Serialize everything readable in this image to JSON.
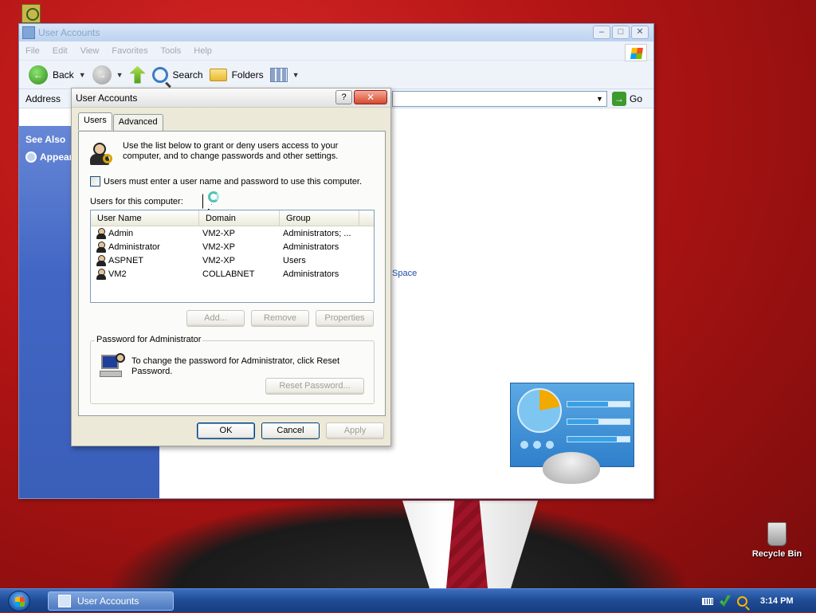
{
  "desktop": {
    "recycle_bin_label": "Recycle Bin"
  },
  "explorer": {
    "title": "User Accounts",
    "menu": [
      "File",
      "Edit",
      "View",
      "Favorites",
      "Tools",
      "Help"
    ],
    "toolbar": {
      "back_label": "Back",
      "search_label": "Search",
      "folders_label": "Folders"
    },
    "address_label": "Address",
    "go_label": "Go",
    "side_pane": {
      "see_also_label": "See Also",
      "appearance_label": "Appear"
    },
    "content_link_fragment": "Space"
  },
  "dialog": {
    "title": "User Accounts",
    "help_glyph": "?",
    "close_glyph": "✕",
    "tabs": [
      {
        "label": "Users",
        "active": true
      },
      {
        "label": "Advanced",
        "active": false
      }
    ],
    "intro_text": "Use the list below to grant or deny users access to your computer, and to change passwords and other settings.",
    "require_login_label": "Users must enter a user name and password to use this computer.",
    "require_login_checked": false,
    "users_list_label": "Users for this computer:",
    "columns": [
      "User Name",
      "Domain",
      "Group"
    ],
    "users": [
      {
        "name": "Admin",
        "domain": "VM2-XP",
        "group": "Administrators; ..."
      },
      {
        "name": "Administrator",
        "domain": "VM2-XP",
        "group": "Administrators"
      },
      {
        "name": "ASPNET",
        "domain": "VM2-XP",
        "group": "Users"
      },
      {
        "name": "VM2",
        "domain": "COLLABNET",
        "group": "Administrators"
      }
    ],
    "buttons": {
      "add": "Add...",
      "remove": "Remove",
      "properties": "Properties",
      "reset_password": "Reset Password...",
      "ok": "OK",
      "cancel": "Cancel",
      "apply": "Apply"
    },
    "password_group_label": "Password for Administrator",
    "password_text": "To change the password for Administrator, click Reset Password."
  },
  "taskbar": {
    "task_label": "User Accounts",
    "clock": "3:14 PM"
  },
  "colors": {
    "desktop_red": "#b51818",
    "xp_blue": "#3a5fb9",
    "dialog_bg": "#ece9d8"
  }
}
